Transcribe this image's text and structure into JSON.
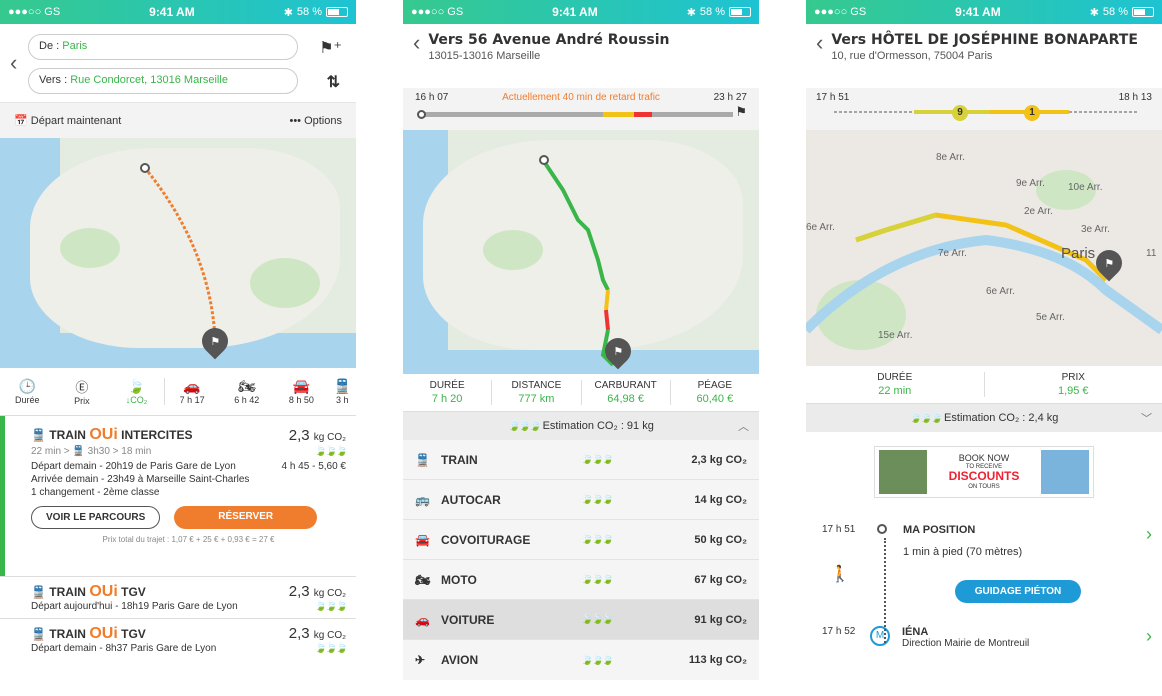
{
  "status": {
    "carrier": "●●●○○ GS",
    "time": "9:41 AM",
    "battery": "58 %"
  },
  "s1": {
    "from_label": "De :",
    "from": "Paris",
    "to_label": "Vers :",
    "to": "Rue Condorcet, 13016 Marseille",
    "depart": "Départ maintenant",
    "options": "••• Options",
    "modes": [
      {
        "l": "Durée",
        "i": "🕒"
      },
      {
        "l": "Prix",
        "i": "€"
      },
      {
        "l": "↓CO₂",
        "i": "🍃"
      },
      {
        "l": "7 h 17",
        "i": "🚗"
      },
      {
        "l": "6 h 42",
        "i": "🏍"
      },
      {
        "l": "8 h 50",
        "i": "🚘"
      },
      {
        "l": "3 h",
        "i": "🚆"
      }
    ],
    "routes": [
      {
        "type": "TRAIN",
        "brand": "OUi",
        "sub": "INTERCITES",
        "co2": "2,3",
        "unit": "kg CO₂",
        "detail": "22 min > 🚆 3h30 > 18 min",
        "d1": "Départ demain - 20h19 de Paris Gare de Lyon",
        "d1r": "4 h 45 - 5,60 €",
        "d2": "Arrivée demain - 23h49 à Marseille Saint-Charles",
        "d3": "1 changement - 2ème classe",
        "btn1": "VOIR LE PARCOURS",
        "btn2": "RÉSERVER",
        "total": "Prix total du trajet : 1,07 € + 25 € + 0,93 € = 27 €"
      },
      {
        "type": "TRAIN",
        "brand": "OUi",
        "sub": "TGV",
        "co2": "2,3",
        "unit": "kg CO₂",
        "d1": "Départ aujourd'hui - 18h19 Paris Gare de Lyon"
      },
      {
        "type": "TRAIN",
        "brand": "OUi",
        "sub": "TGV",
        "co2": "2,3",
        "unit": "kg CO₂",
        "d1": "Départ demain - 8h37 Paris Gare de Lyon"
      }
    ]
  },
  "s2": {
    "title": "Vers 56 Avenue André Roussin",
    "sub": "13015-13016 Marseille",
    "t_start": "16 h 07",
    "t_end": "23 h 27",
    "delay": "Actuellement 40 min de retard trafic",
    "stats": [
      {
        "l": "DURÉE",
        "v": "7 h 20"
      },
      {
        "l": "DISTANCE",
        "v": "777 km"
      },
      {
        "l": "CARBURANT",
        "v": "64,98 €"
      },
      {
        "l": "PÉAGE",
        "v": "60,40 €"
      }
    ],
    "estimate": "Estimation CO₂ : 91 kg",
    "rows": [
      {
        "i": "🚆",
        "l": "TRAIN",
        "leaves": 3,
        "v": "2,3 kg CO₂"
      },
      {
        "i": "🚌",
        "l": "AUTOCAR",
        "leaves": 2,
        "v": "14 kg CO₂"
      },
      {
        "i": "🚘",
        "l": "COVOITURAGE",
        "leaves": 2,
        "v": "50 kg CO₂"
      },
      {
        "i": "🏍",
        "l": "MOTO",
        "leaves": 0,
        "v": "67 kg CO₂"
      },
      {
        "i": "🚗",
        "l": "VOITURE",
        "leaves": 0,
        "v": "91 kg CO₂"
      },
      {
        "i": "✈",
        "l": "AVION",
        "leaves": 0,
        "v": "113 kg CO₂"
      }
    ]
  },
  "s3": {
    "title": "Vers HÔTEL DE JOSÉPHINE BONAPARTE",
    "sub": "10, rue d'Ormesson, 75004 Paris",
    "t_start": "17 h 51",
    "t_end": "18 h 13",
    "badge1": "9",
    "badge2": "1",
    "stats": [
      {
        "l": "DURÉE",
        "v": "22 min"
      },
      {
        "l": "PRIX",
        "v": "1,95 €"
      }
    ],
    "estimate": "Estimation CO₂ : 2,4 kg",
    "ad": {
      "l1": "BOOK NOW",
      "l2": "TO RECEIVE",
      "l3": "DISCOUNTS",
      "l4": "ON TOURS"
    },
    "steps": [
      {
        "t": "17 h 51",
        "title": "MA POSITION",
        "detail": "1 min à pied (70 mètres)",
        "btn": "GUIDAGE PIÉTON"
      },
      {
        "t": "17 h 52",
        "title": "IÉNA",
        "detail": "Direction Mairie de Montreuil"
      }
    ],
    "map_labels": [
      "8e Arr.",
      "9e Arr.",
      "10e Arr.",
      "2e Arr.",
      "3e Arr.",
      "6e Arr.",
      "7e Arr.",
      "Paris",
      "6e Arr.",
      "5e Arr.",
      "15e Arr.",
      "11"
    ]
  },
  "colors": {
    "green": "#3ab54a",
    "orange": "#f07d2e",
    "blue": "#1e9bd7",
    "yellow": "#f3c217"
  }
}
